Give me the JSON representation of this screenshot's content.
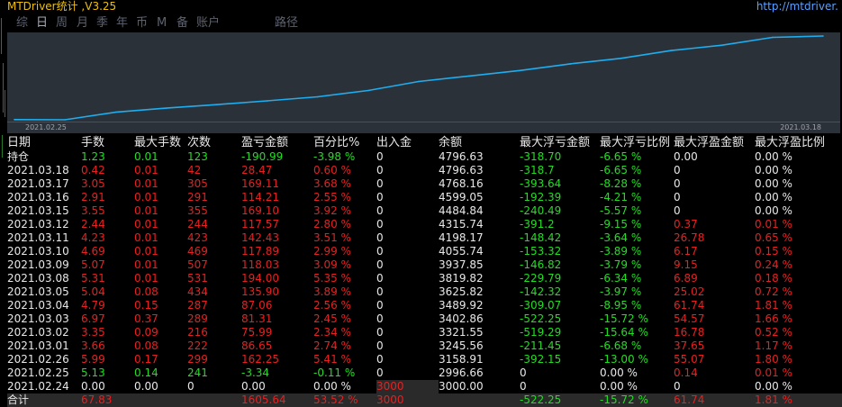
{
  "title": "MTDriver统计 ,V3.25",
  "url": "http://mtdriver.",
  "tabs": [
    {
      "label": "综",
      "active": false
    },
    {
      "label": "日",
      "active": true
    },
    {
      "label": "周",
      "active": false
    },
    {
      "label": "月",
      "active": false
    },
    {
      "label": "季",
      "active": false
    },
    {
      "label": "年",
      "active": false
    },
    {
      "label": "币",
      "active": false
    },
    {
      "label": "M",
      "active": false
    },
    {
      "label": "备",
      "active": false
    },
    {
      "label": "账户",
      "active": false
    },
    {
      "label": "路径",
      "active": false
    }
  ],
  "colors": {
    "accent_green": "#22dd22",
    "accent_red": "#e82020",
    "chart_line": "#1eaef0",
    "chart_bg": "#2b3139",
    "title": "#f0c000",
    "url": "#5aa0ff"
  },
  "chart_data": {
    "type": "line",
    "x_start_label": "2021.02.25",
    "x_end_label": "2021.03.18",
    "x": [
      "2021.02.24",
      "2021.02.25",
      "2021.02.26",
      "2021.03.01",
      "2021.03.02",
      "2021.03.03",
      "2021.03.04",
      "2021.03.05",
      "2021.03.08",
      "2021.03.09",
      "2021.03.10",
      "2021.03.11",
      "2021.03.12",
      "2021.03.15",
      "2021.03.16",
      "2021.03.17",
      "2021.03.18"
    ],
    "series": [
      {
        "values": [
          3000.0,
          2996.66,
          3158.91,
          3245.56,
          3321.55,
          3402.86,
          3489.92,
          3625.82,
          3819.82,
          3937.85,
          4055.74,
          4198.17,
          4315.74,
          4484.84,
          4599.05,
          4768.16,
          4796.63
        ]
      }
    ]
  },
  "table": {
    "headers": [
      "日期",
      "手数",
      "最大手数",
      "次数",
      "盈亏金额",
      "百分比%",
      "出入金",
      "余额",
      "最大浮亏金额",
      "最大浮亏比例",
      "最大浮盈金额",
      "最大浮盈比例"
    ],
    "holding": {
      "date": "持仓",
      "lots": "1.23",
      "max_lots": "0.01",
      "count": "123",
      "pnl": "-190.99",
      "pct": "-3.98 %",
      "deposit": "0",
      "balance": "4796.63",
      "max_float_loss": "-318.70",
      "max_float_loss_pct": "-6.65 %",
      "max_float_profit": "0.00",
      "max_float_profit_pct": "0.00 %",
      "color": "green"
    },
    "rows": [
      {
        "date": "2021.03.18",
        "lots": "0.42",
        "max_lots": "0.01",
        "count": "42",
        "pnl": "28.47",
        "pct": "0.60 %",
        "deposit": "0",
        "balance": "4796.63",
        "max_float_loss": "-318.7",
        "max_float_loss_pct": "-6.65 %",
        "max_float_profit": "0",
        "max_float_profit_pct": "0.00 %",
        "color": "red",
        "fp_color": "white"
      },
      {
        "date": "2021.03.17",
        "lots": "3.05",
        "max_lots": "0.01",
        "count": "305",
        "pnl": "169.11",
        "pct": "3.68 %",
        "deposit": "0",
        "balance": "4768.16",
        "max_float_loss": "-393.64",
        "max_float_loss_pct": "-8.28 %",
        "max_float_profit": "0",
        "max_float_profit_pct": "0.00 %",
        "color": "red",
        "fp_color": "white"
      },
      {
        "date": "2021.03.16",
        "lots": "2.91",
        "max_lots": "0.01",
        "count": "291",
        "pnl": "114.21",
        "pct": "2.55 %",
        "deposit": "0",
        "balance": "4599.05",
        "max_float_loss": "-192.39",
        "max_float_loss_pct": "-4.21 %",
        "max_float_profit": "0",
        "max_float_profit_pct": "0.00 %",
        "color": "red",
        "fp_color": "white"
      },
      {
        "date": "2021.03.15",
        "lots": "3.55",
        "max_lots": "0.01",
        "count": "355",
        "pnl": "169.10",
        "pct": "3.92 %",
        "deposit": "0",
        "balance": "4484.84",
        "max_float_loss": "-240.49",
        "max_float_loss_pct": "-5.57 %",
        "max_float_profit": "0",
        "max_float_profit_pct": "0.00 %",
        "color": "red",
        "fp_color": "white"
      },
      {
        "date": "2021.03.12",
        "lots": "2.44",
        "max_lots": "0.01",
        "count": "244",
        "pnl": "117.57",
        "pct": "2.80 %",
        "deposit": "0",
        "balance": "4315.74",
        "max_float_loss": "-391.2",
        "max_float_loss_pct": "-9.15 %",
        "max_float_profit": "0.37",
        "max_float_profit_pct": "0.01 %",
        "color": "red",
        "fp_color": "red"
      },
      {
        "date": "2021.03.11",
        "lots": "4.23",
        "max_lots": "0.01",
        "count": "423",
        "pnl": "142.43",
        "pct": "3.51 %",
        "deposit": "0",
        "balance": "4198.17",
        "max_float_loss": "-148.42",
        "max_float_loss_pct": "-3.64 %",
        "max_float_profit": "26.78",
        "max_float_profit_pct": "0.65 %",
        "color": "red",
        "fp_color": "red"
      },
      {
        "date": "2021.03.10",
        "lots": "4.69",
        "max_lots": "0.01",
        "count": "469",
        "pnl": "117.89",
        "pct": "2.99 %",
        "deposit": "0",
        "balance": "4055.74",
        "max_float_loss": "-153.32",
        "max_float_loss_pct": "-3.89 %",
        "max_float_profit": "6.17",
        "max_float_profit_pct": "0.15 %",
        "color": "red",
        "fp_color": "red"
      },
      {
        "date": "2021.03.09",
        "lots": "5.07",
        "max_lots": "0.01",
        "count": "507",
        "pnl": "118.03",
        "pct": "3.09 %",
        "deposit": "0",
        "balance": "3937.85",
        "max_float_loss": "-146.82",
        "max_float_loss_pct": "-3.79 %",
        "max_float_profit": "9.15",
        "max_float_profit_pct": "0.24 %",
        "color": "red",
        "fp_color": "red"
      },
      {
        "date": "2021.03.08",
        "lots": "5.31",
        "max_lots": "0.01",
        "count": "531",
        "pnl": "194.00",
        "pct": "5.35 %",
        "deposit": "0",
        "balance": "3819.82",
        "max_float_loss": "-229.79",
        "max_float_loss_pct": "-6.34 %",
        "max_float_profit": "6.89",
        "max_float_profit_pct": "0.18 %",
        "color": "red",
        "fp_color": "red"
      },
      {
        "date": "2021.03.05",
        "lots": "5.04",
        "max_lots": "0.08",
        "count": "434",
        "pnl": "135.90",
        "pct": "3.89 %",
        "deposit": "0",
        "balance": "3625.82",
        "max_float_loss": "-142.32",
        "max_float_loss_pct": "-3.97 %",
        "max_float_profit": "25.02",
        "max_float_profit_pct": "0.72 %",
        "color": "red",
        "fp_color": "red"
      },
      {
        "date": "2021.03.04",
        "lots": "4.79",
        "max_lots": "0.15",
        "count": "287",
        "pnl": "87.06",
        "pct": "2.56 %",
        "deposit": "0",
        "balance": "3489.92",
        "max_float_loss": "-309.07",
        "max_float_loss_pct": "-8.95 %",
        "max_float_profit": "61.74",
        "max_float_profit_pct": "1.81 %",
        "color": "red",
        "fp_color": "red"
      },
      {
        "date": "2021.03.03",
        "lots": "6.97",
        "max_lots": "0.37",
        "count": "289",
        "pnl": "81.31",
        "pct": "2.45 %",
        "deposit": "0",
        "balance": "3402.86",
        "max_float_loss": "-522.25",
        "max_float_loss_pct": "-15.72 %",
        "max_float_profit": "54.57",
        "max_float_profit_pct": "1.66 %",
        "color": "red",
        "fp_color": "red"
      },
      {
        "date": "2021.03.02",
        "lots": "3.35",
        "max_lots": "0.09",
        "count": "216",
        "pnl": "75.99",
        "pct": "2.34 %",
        "deposit": "0",
        "balance": "3321.55",
        "max_float_loss": "-519.29",
        "max_float_loss_pct": "-15.64 %",
        "max_float_profit": "16.78",
        "max_float_profit_pct": "0.52 %",
        "color": "red",
        "fp_color": "red"
      },
      {
        "date": "2021.03.01",
        "lots": "3.66",
        "max_lots": "0.08",
        "count": "222",
        "pnl": "86.65",
        "pct": "2.74 %",
        "deposit": "0",
        "balance": "3245.56",
        "max_float_loss": "-211.45",
        "max_float_loss_pct": "-6.68 %",
        "max_float_profit": "37.65",
        "max_float_profit_pct": "1.17 %",
        "color": "red",
        "fp_color": "red"
      },
      {
        "date": "2021.02.26",
        "lots": "5.99",
        "max_lots": "0.17",
        "count": "299",
        "pnl": "162.25",
        "pct": "5.41 %",
        "deposit": "0",
        "balance": "3158.91",
        "max_float_loss": "-392.15",
        "max_float_loss_pct": "-13.00 %",
        "max_float_profit": "55.07",
        "max_float_profit_pct": "1.80 %",
        "color": "red",
        "fp_color": "red"
      },
      {
        "date": "2021.02.25",
        "lots": "5.13",
        "max_lots": "0.14",
        "count": "241",
        "pnl": "-3.34",
        "pct": "-0.11 %",
        "deposit": "0",
        "balance": "2996.66",
        "max_float_loss": "0",
        "max_float_loss_pct": "0.00 %",
        "max_float_profit": "0.14",
        "max_float_profit_pct": "0.01 %",
        "color": "green",
        "fp_color": "red",
        "fl_color": "white"
      },
      {
        "date": "2021.02.24",
        "lots": "0.00",
        "max_lots": "0.00",
        "count": "0",
        "pnl": "0.00",
        "pct": "0.00 %",
        "deposit": "3000",
        "balance": "3000.00",
        "max_float_loss": "0",
        "max_float_loss_pct": "0.00 %",
        "max_float_profit": "0",
        "max_float_profit_pct": "0.00 %",
        "color": "white",
        "fp_color": "white",
        "fl_color": "white",
        "deposit_shaded": true
      }
    ],
    "total": {
      "date": "合计",
      "lots": "67.83",
      "max_lots": "",
      "count": "",
      "pnl": "1605.64",
      "pct": "53.52 %",
      "deposit": "3000",
      "balance": "",
      "max_float_loss": "-522.25",
      "max_float_loss_pct": "-15.72 %",
      "max_float_profit": "61.74",
      "max_float_profit_pct": "1.81 %"
    }
  }
}
